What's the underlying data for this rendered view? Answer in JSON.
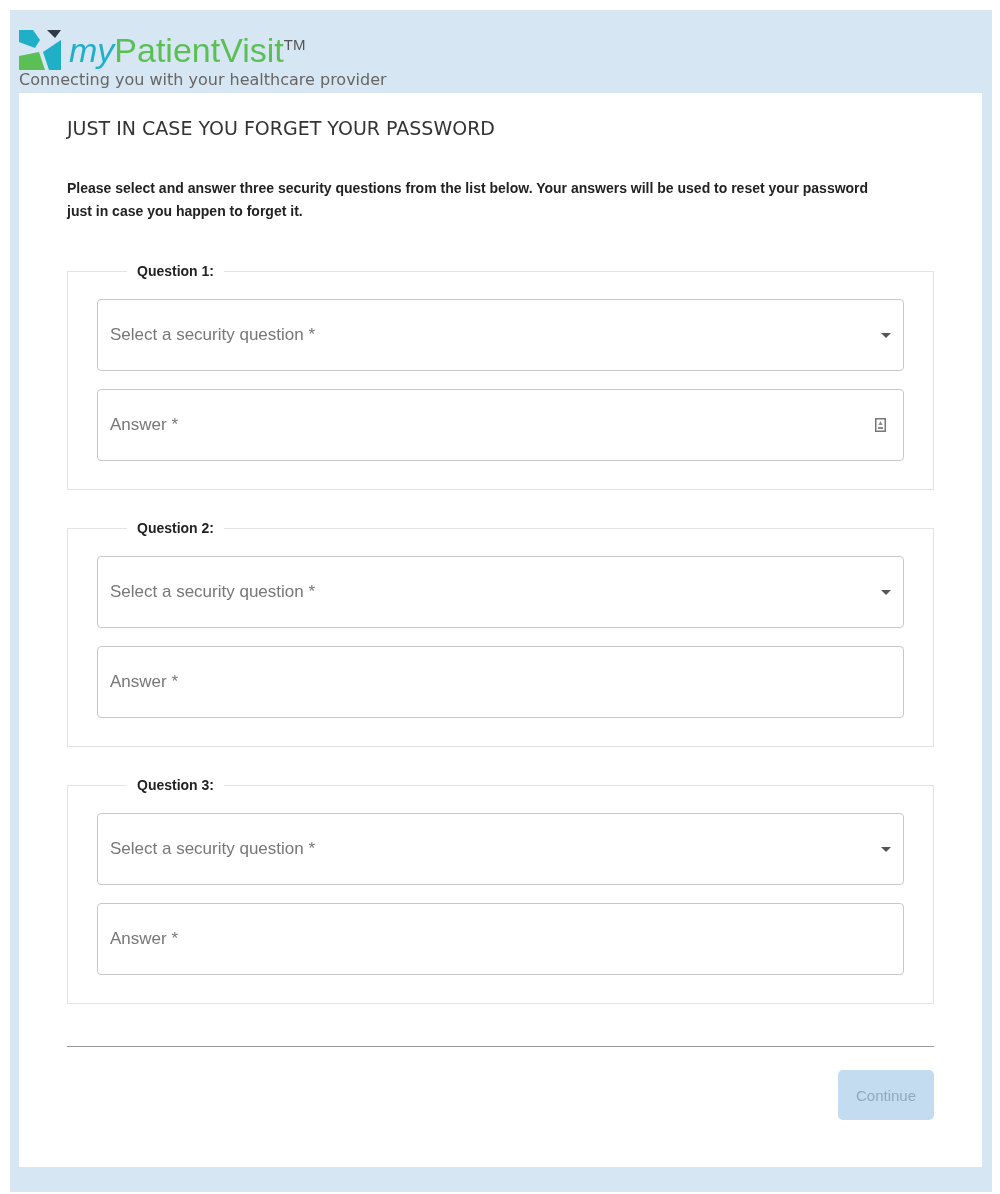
{
  "logo": {
    "prefix": "my",
    "name": "PatientVisit",
    "mark": "TM"
  },
  "tagline": "Connecting you with your healthcare provider",
  "title": "JUST IN CASE YOU FORGET YOUR PASSWORD",
  "intro": "Please select and answer three security questions from the list below. Your answers will be used to reset your password just in case you happen to forget it.",
  "questions": [
    {
      "legend": "Question 1:",
      "select_placeholder": "Select a security question *",
      "answer_placeholder": "Answer *",
      "answer_icon": true
    },
    {
      "legend": "Question 2:",
      "select_placeholder": "Select a security question *",
      "answer_placeholder": "Answer *",
      "answer_icon": false
    },
    {
      "legend": "Question 3:",
      "select_placeholder": "Select a security question *",
      "answer_placeholder": "Answer *",
      "answer_icon": false
    }
  ],
  "continue_button": {
    "label": "Continue",
    "disabled": true
  }
}
